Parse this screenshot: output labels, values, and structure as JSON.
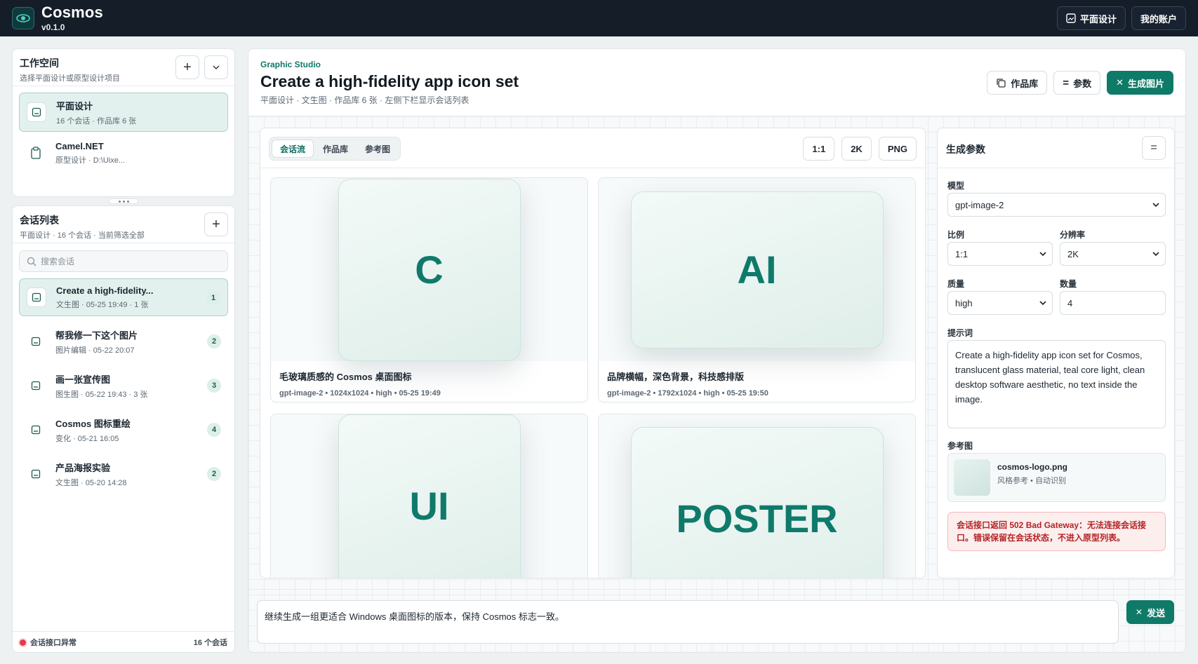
{
  "app": {
    "name": "Cosmos",
    "version": "v0.1.0"
  },
  "topbar": {
    "design_label": "平面设计",
    "account_label": "我的账户"
  },
  "workspace": {
    "title": "工作空间",
    "subtitle": "选择平面设计或原型设计项目",
    "items": [
      {
        "title": "平面设计",
        "meta": "16 个会话 · 作品库 6 张"
      },
      {
        "title": "Camel.NET",
        "meta": "原型设计 · D:\\Uixe..."
      }
    ]
  },
  "conversations": {
    "title": "会话列表",
    "subtitle": "平面设计 · 16 个会话 · 当前筛选全部",
    "search_placeholder": "搜索会话",
    "items": [
      {
        "title": "Create a high-fidelity...",
        "meta": "文生图 · 05-25 19:49 · 1 张",
        "count": "1"
      },
      {
        "title": "帮我修一下这个图片",
        "meta": "图片编辑 · 05-22 20:07",
        "count": "2"
      },
      {
        "title": "画一张宣传图",
        "meta": "图生图 · 05-22 19:43 · 3 张",
        "count": "3"
      },
      {
        "title": "Cosmos 图标重绘",
        "meta": "变化 · 05-21 16:05",
        "count": "4"
      },
      {
        "title": "产品海报实验",
        "meta": "文生图 · 05-20 14:28",
        "count": "2"
      }
    ],
    "status": "会话接口异常",
    "total": "16 个会话"
  },
  "main": {
    "eyebrow": "Graphic Studio",
    "title": "Create a high-fidelity app icon set",
    "subtitle": "平面设计 · 文生图 · 作品库 6 张 · 左侧下栏显示会话列表",
    "gallery_label": "作品库",
    "params_label": "参数",
    "generate_label": "生成图片",
    "tabs": [
      "会话流",
      "作品库",
      "参考图"
    ],
    "opts": [
      "1:1",
      "2K",
      "PNG"
    ],
    "cards": [
      {
        "glyph": "C",
        "title": "毛玻璃质感的 Cosmos 桌面图标",
        "meta": "gpt-image-2 • 1024x1024 • high • 05-25 19:49"
      },
      {
        "glyph": "AI",
        "title": "品牌横幅，深色背景，科技感排版",
        "meta": "gpt-image-2 • 1792x1024 • high • 05-25 19:50"
      },
      {
        "glyph": "UI",
        "title": "",
        "meta": ""
      },
      {
        "glyph": "POSTER",
        "title": "",
        "meta": ""
      }
    ],
    "composer_value": "继续生成一组更适合 Windows 桌面图标的版本，保持 Cosmos 标志一致。",
    "send_label": "发送"
  },
  "params": {
    "title": "生成参数",
    "model_label": "模型",
    "model": "gpt-image-2",
    "ratio_label": "比例",
    "ratio": "1:1",
    "res_label": "分辨率",
    "res": "2K",
    "quality_label": "质量",
    "quality": "high",
    "count_label": "数量",
    "count": "4",
    "prompt_label": "提示词",
    "prompt": "Create a high-fidelity app icon set for Cosmos, translucent glass material, teal core light, clean desktop software aesthetic, no text inside the image.",
    "ref_label": "参考图",
    "ref_name": "cosmos-logo.png",
    "ref_meta": "风格参考 • 自动识别",
    "error": "会话接口返回 502 Bad Gateway：无法连接会话接口。错误保留在会话状态，不进入原型列表。"
  },
  "colors": {
    "accent": "#0f7a68",
    "topbar": "#141d28",
    "error_bg": "#fdeeee",
    "error_text": "#b42323"
  }
}
